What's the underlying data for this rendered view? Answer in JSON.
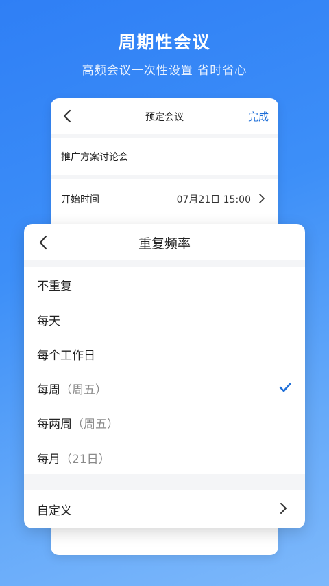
{
  "promo": {
    "title": "周期性会议",
    "subtitle": "高频会议一次性设置 省时省心"
  },
  "booking_screen": {
    "title": "预定会议",
    "done_label": "完成",
    "meeting_name": "推广方案讨论会",
    "start_time_label": "开始时间",
    "start_time_value": "07月21日 15:00"
  },
  "repeat_sheet": {
    "title": "重复频率",
    "options": [
      {
        "label": "不重复",
        "hint": ""
      },
      {
        "label": "每天",
        "hint": ""
      },
      {
        "label": "每个工作日",
        "hint": ""
      },
      {
        "label": "每周",
        "hint": "（周五）",
        "selected": true
      },
      {
        "label": "每两周",
        "hint": "（周五）"
      },
      {
        "label": "每月",
        "hint": "（21日）"
      }
    ],
    "custom_label": "自定义"
  },
  "colors": {
    "accent": "#1f6fd8",
    "check": "#1f6fd8",
    "background_top": "#2f7ff5",
    "background_bottom": "#7db8fb"
  },
  "icons": {
    "back": "chevron-left-icon",
    "forward": "chevron-right-icon",
    "selected": "check-icon"
  }
}
